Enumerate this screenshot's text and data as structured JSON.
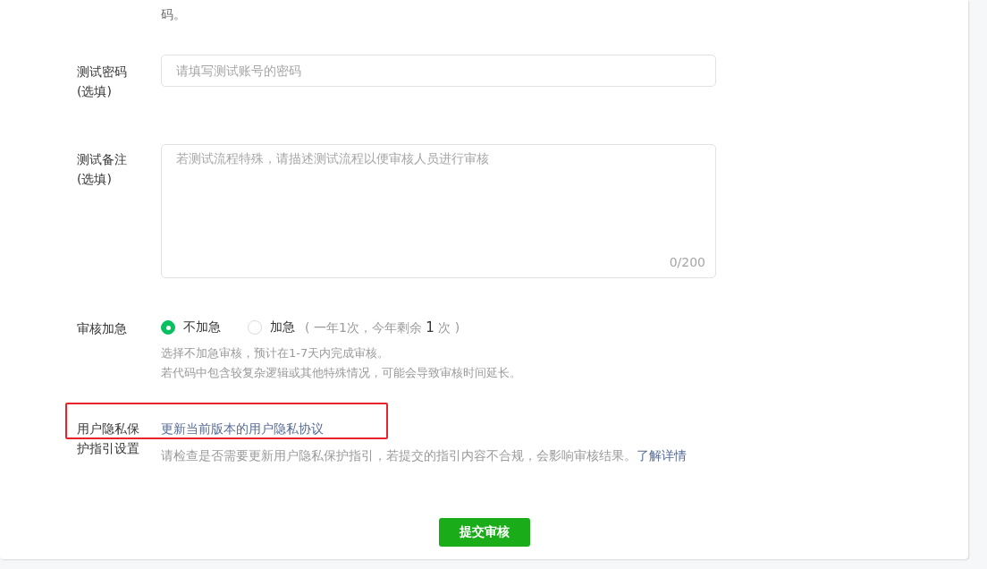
{
  "top_text": "码。",
  "password": {
    "label": "测试密码",
    "sublabel": "(选填)",
    "placeholder": "请填写测试账号的密码"
  },
  "notes": {
    "label": "测试备注",
    "sublabel": "(选填)",
    "placeholder": "若测试流程特殊，请描述测试流程以便审核人员进行审核",
    "counter": "0/200"
  },
  "urgent": {
    "label": "审核加急",
    "options": [
      {
        "label": "不加急",
        "selected": true
      },
      {
        "label": "加急",
        "note": "( 一年1次，今年剩余 **1** 次 )",
        "selected": false
      }
    ],
    "hints": [
      "选择不加急审核，预计在1-7天内完成审核。",
      "若代码中包含较复杂逻辑或其他特殊情况，可能会导致审核时间延长。"
    ]
  },
  "privacy": {
    "label": "用户隐私保护指引设置",
    "link": "更新当前版本的用户隐私协议",
    "hint": "请检查是否需要更新用户隐私保护指引，若提交的指引内容不合规，会影响审核结果。",
    "hint_link": "了解详情",
    "highlighted": true
  },
  "submit": "提交审核"
}
